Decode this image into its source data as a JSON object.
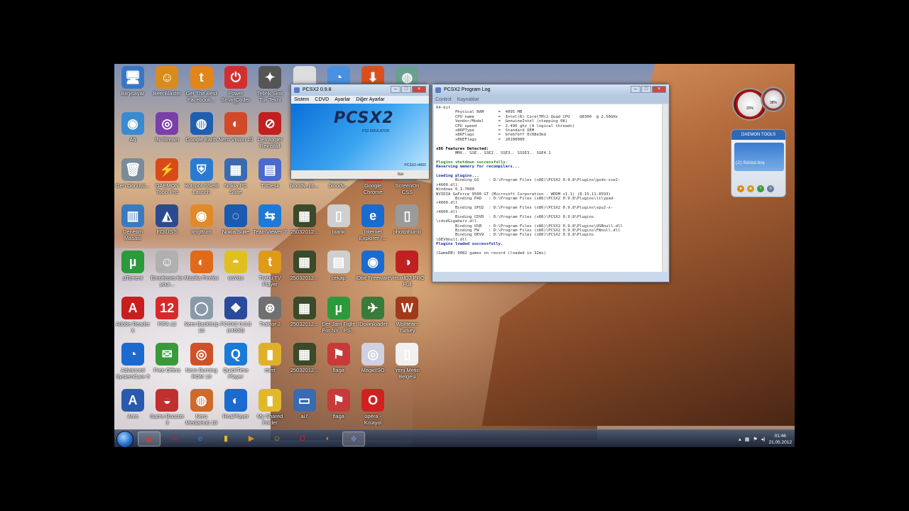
{
  "desktop": {
    "icons": [
      {
        "label": "Bilgisayar",
        "color": "#3a76c4",
        "glyph": "🖥",
        "col": 0,
        "row": 0
      },
      {
        "label": "BeerBlaster",
        "color": "#d88c1e",
        "glyph": "☺",
        "col": 1,
        "row": 0
      },
      {
        "label": "Get The Best Facebook...",
        "color": "#e0861a",
        "glyph": "t",
        "col": 2,
        "row": 0
      },
      {
        "label": "Power SmartCoder 10",
        "color": "#d23030",
        "glyph": "⏻",
        "col": 3,
        "row": 0
      },
      {
        "label": "Tebrik Sinir Tür Tekni",
        "color": "#555",
        "glyph": "✦",
        "col": 4,
        "row": 0
      },
      {
        "label": "Ağ",
        "color": "#3a8ad0",
        "glyph": "◉",
        "col": 0,
        "row": 1
      },
      {
        "label": "IN Stream",
        "color": "#7a3fa8",
        "glyph": "◎",
        "col": 1,
        "row": 1
      },
      {
        "label": "Google Earth",
        "color": "#1e5fb0",
        "glyph": "◍",
        "col": 2,
        "row": 1
      },
      {
        "label": "Nero Vision 10",
        "color": "#d04a2a",
        "glyph": "◐",
        "col": 3,
        "row": 1
      },
      {
        "label": "Defraggler Reinstall",
        "color": "#c02020",
        "glyph": "⊘",
        "col": 4,
        "row": 1
      },
      {
        "label": "Geri Dönüşü...",
        "color": "#7a8b9a",
        "glyph": "🗑",
        "col": 0,
        "row": 2
      },
      {
        "label": "DAEMON Tools Pro",
        "color": "#d84a1a",
        "glyph": "⚡",
        "col": 1,
        "row": 2
      },
      {
        "label": "Hotspot Shield Launch",
        "color": "#2a7ad0",
        "glyph": "⛨",
        "col": 2,
        "row": 2
      },
      {
        "label": "Nokia PC Suite",
        "color": "#3a6ab0",
        "glyph": "▦",
        "col": 3,
        "row": 2
      },
      {
        "label": "T3Desk",
        "color": "#4a6ad0",
        "glyph": "▤",
        "col": 4,
        "row": 2
      },
      {
        "label": "Denetim Masası",
        "color": "#3a7ac0",
        "glyph": "▥",
        "col": 0,
        "row": 3
      },
      {
        "label": "EDIUS 5",
        "color": "#2a4a90",
        "glyph": "◭",
        "col": 1,
        "row": 3
      },
      {
        "label": "ImgBurn",
        "color": "#e08a2a",
        "glyph": "◉",
        "col": 2,
        "row": 3
      },
      {
        "label": "Nokia Suite",
        "color": "#1a5ab0",
        "glyph": "◌",
        "col": 3,
        "row": 3
      },
      {
        "label": "TeamViewer 7",
        "color": "#1e7ad6",
        "glyph": "⇆",
        "col": 4,
        "row": 3
      },
      {
        "label": "µTorrent",
        "color": "#2a9a3a",
        "glyph": "µ",
        "col": 0,
        "row": 4
      },
      {
        "label": "Emoticons for your...",
        "color": "#b0b0b0",
        "glyph": "☺",
        "col": 1,
        "row": 4
      },
      {
        "label": "Mozilla Firefox",
        "color": "#e06a1a",
        "glyph": "◐",
        "col": 2,
        "row": 4
      },
      {
        "label": "ooVoo",
        "color": "#e0c020",
        "glyph": "◓",
        "col": 3,
        "row": 4
      },
      {
        "label": "Tivibu TV Player",
        "color": "#e09a1a",
        "glyph": "t",
        "col": 4,
        "row": 4
      },
      {
        "label": "Adobe Reader X",
        "color": "#c81e1e",
        "glyph": "A",
        "col": 0,
        "row": 5
      },
      {
        "label": "FIFA 12",
        "color": "#d82a2a",
        "glyph": "12",
        "col": 1,
        "row": 5
      },
      {
        "label": "Nero BackItUp 10",
        "color": "#8a9aa8",
        "glyph": "◯",
        "col": 2,
        "row": 5
      },
      {
        "label": "PCSX2 0.9.8 (r4600)",
        "color": "#2a4a9a",
        "glyph": "❖",
        "col": 3,
        "row": 5
      },
      {
        "label": "Traktor 2",
        "color": "#707070",
        "glyph": "⊛",
        "col": 4,
        "row": 5
      },
      {
        "label": "Advanced SystemCare 5",
        "color": "#1a6ad0",
        "glyph": "◔",
        "col": 0,
        "row": 6
      },
      {
        "label": "Free Offers",
        "color": "#3a9a3a",
        "glyph": "✉",
        "col": 1,
        "row": 6
      },
      {
        "label": "Nero Burning ROM 10",
        "color": "#d0502a",
        "glyph": "◎",
        "col": 2,
        "row": 6
      },
      {
        "label": "QuickTime Player",
        "color": "#1a7ad8",
        "glyph": "Q",
        "col": 3,
        "row": 6
      },
      {
        "label": "mert",
        "color": "#e0b02a",
        "glyph": "▮",
        "col": 4,
        "row": 6
      },
      {
        "label": "Ares",
        "color": "#2a5ab0",
        "glyph": "A",
        "col": 0,
        "row": 7
      },
      {
        "label": "Game Booster 3",
        "color": "#c03030",
        "glyph": "◒",
        "col": 1,
        "row": 7
      },
      {
        "label": "Nero MediaHub 10",
        "color": "#d06a2a",
        "glyph": "◍",
        "col": 2,
        "row": 7
      },
      {
        "label": "RealPlayer",
        "color": "#1a6ad0",
        "glyph": "◐",
        "col": 3,
        "row": 7
      },
      {
        "label": "My Shared Folder",
        "color": "#e0b82a",
        "glyph": "▮",
        "col": 4,
        "row": 7
      },
      {
        "label": "",
        "color": "#ddd",
        "glyph": "",
        "col": 5,
        "row": 0
      },
      {
        "label": "",
        "color": "#4a90e0",
        "glyph": "◔",
        "col": 6,
        "row": 0
      },
      {
        "label": "",
        "color": "#d85020",
        "glyph": "⬇",
        "col": 7,
        "row": 0
      },
      {
        "label": "",
        "color": "#6aa090",
        "glyph": "◍",
        "col": 8,
        "row": 0
      },
      {
        "label": "bloody_ps...",
        "color": "#9a9a9a",
        "glyph": "▦",
        "col": 5,
        "row": 2
      },
      {
        "label": "bloody...",
        "color": "#9a9a9a",
        "glyph": "▦",
        "col": 6,
        "row": 2
      },
      {
        "label": "Google Chrome",
        "color": "#d04030",
        "glyph": "◉",
        "col": 7,
        "row": 2
      },
      {
        "label": "ScreenOn CSS",
        "color": "#8a8a8a",
        "glyph": "▦",
        "col": 8,
        "row": 2
      },
      {
        "label": "25032012...",
        "color": "#3a4a2a",
        "glyph": "▦",
        "col": 5,
        "row": 3
      },
      {
        "label": "blank",
        "color": "#cfcfcf",
        "glyph": "▯",
        "col": 6,
        "row": 3
      },
      {
        "label": "Internet Explorer (...",
        "color": "#1a6ad0",
        "glyph": "e",
        "col": 7,
        "row": 3
      },
      {
        "label": "photothumb",
        "color": "#9a9a9a",
        "glyph": "▯",
        "col": 8,
        "row": 3
      },
      {
        "label": "25032012...",
        "color": "#3a4a2a",
        "glyph": "▦",
        "col": 5,
        "row": 4
      },
      {
        "label": "cekap",
        "color": "#cfcfcf",
        "glyph": "▤",
        "col": 6,
        "row": 4
      },
      {
        "label": "IObit Freeware",
        "color": "#1a6ad0",
        "glyph": "◉",
        "col": 7,
        "row": 4
      },
      {
        "label": "VirtualDJ PRO Full",
        "color": "#c02020",
        "glyph": "◑",
        "col": 8,
        "row": 4
      },
      {
        "label": "25032012...",
        "color": "#3a4a2a",
        "glyph": "▦",
        "col": 5,
        "row": 5
      },
      {
        "label": "Def Jam Fight For NY - PS...",
        "color": "#2a9a3a",
        "glyph": "µ",
        "col": 6,
        "row": 5
      },
      {
        "label": "IDownloader",
        "color": "#3a7a3a",
        "glyph": "✈",
        "col": 7,
        "row": 5
      },
      {
        "label": "Wolfteam Turkey",
        "color": "#a03a1a",
        "glyph": "W",
        "col": 8,
        "row": 5
      },
      {
        "label": "25032012...",
        "color": "#3a4a2a",
        "glyph": "▦",
        "col": 5,
        "row": 6
      },
      {
        "label": "flaga",
        "color": "#c83a3a",
        "glyph": "⚑",
        "col": 6,
        "row": 6
      },
      {
        "label": "MagicISO",
        "color": "#d0d0e0",
        "glyph": "◎",
        "col": 7,
        "row": 6
      },
      {
        "label": "Yeni Metin Belgesi",
        "color": "#f0f0f0",
        "glyph": "▯",
        "col": 8,
        "row": 6
      },
      {
        "label": "ai7",
        "color": "#3a6ab0",
        "glyph": "▭",
        "col": 5,
        "row": 7
      },
      {
        "label": "flaga",
        "color": "#c83a3a",
        "glyph": "⚑",
        "col": 6,
        "row": 7
      },
      {
        "label": "opera - Kısayol",
        "color": "#d02020",
        "glyph": "O",
        "col": 7,
        "row": 7
      }
    ]
  },
  "pcsx2_window": {
    "title": "PCSX2  0.9.8",
    "menu": [
      "Sistem",
      "CDVD",
      "Ayarlar",
      "Diğer Ayarlar"
    ],
    "logo": "PCSX2",
    "logo_sub": "PS2 EMULATOR",
    "version_tag": "PCSX2 r4600",
    "status": "Iso"
  },
  "log_window": {
    "title": "PCSX2 Program Log",
    "menu": [
      "Control",
      "Kaynaklar"
    ],
    "lines": [
      {
        "t": "64-bit",
        "c": ""
      },
      {
        "t": "        Physical RAM      =  4095 MB",
        "c": ""
      },
      {
        "t": "        CPU name          =  Intel(R) Core(TM)2 Quad CPU    Q8300  @ 2.50GHz",
        "c": ""
      },
      {
        "t": "        Vendor/Model      =  GenuineIntel (stepping 0A)",
        "c": ""
      },
      {
        "t": "        CPU speed         =  2.496 ghz (4 logical threads)",
        "c": ""
      },
      {
        "t": "        x86PType          =  Standard OEM",
        "c": ""
      },
      {
        "t": "        x86Flags          =  bfebfbff 0c08e3bd",
        "c": ""
      },
      {
        "t": "        x86EFlags         =  20100000",
        "c": ""
      },
      {
        "t": "",
        "c": ""
      },
      {
        "t": "x86 Features Detected:",
        "c": "hl"
      },
      {
        "t": "        MMX.. SSE.. SSE2.. SSE3.. SSSE3.. SSE4.1",
        "c": ""
      },
      {
        "t": "",
        "c": ""
      },
      {
        "t": "Plugins shutdown successfully.",
        "c": "ok"
      },
      {
        "t": "Reserving memory for recompilers...",
        "c": "blue"
      },
      {
        "t": "",
        "c": ""
      },
      {
        "t": "Loading plugins...",
        "c": "blue"
      },
      {
        "t": "        Binding GS    : D:\\Program Files (x86)\\PCSX2 0.9.8\\Plugins\\gsdx-sse2-",
        "c": ""
      },
      {
        "t": "r4600.dll",
        "c": ""
      },
      {
        "t": "Windows 6.1.7600",
        "c": ""
      },
      {
        "t": "NVIDIA GeForce 9500 GT (Microsoft Corporation - WDDM v1.1) (8.15.11.8593)",
        "c": ""
      },
      {
        "t": "        Binding PAD   : D:\\Program Files (x86)\\PCSX2 0.9.8\\Plugins\\lilypad-",
        "c": ""
      },
      {
        "t": "r4600.dll",
        "c": ""
      },
      {
        "t": "        Binding SPU2  : D:\\Program Files (x86)\\PCSX2 0.9.8\\Plugins\\spu2-x-",
        "c": ""
      },
      {
        "t": "r4600.dll",
        "c": ""
      },
      {
        "t": "        Binding CDVD  : D:\\Program Files (x86)\\PCSX2 0.9.8\\Plugins",
        "c": ""
      },
      {
        "t": "\\cdvdGigaherz.dll",
        "c": ""
      },
      {
        "t": "        Binding USB   : D:\\Program Files (x86)\\PCSX2 0.9.8\\Plugins\\USBnull.dll",
        "c": ""
      },
      {
        "t": "        Binding FW    : D:\\Program Files (x86)\\PCSX2 0.9.8\\Plugins\\FWnull.dll",
        "c": ""
      },
      {
        "t": "        Binding DEV9  : D:\\Program Files (x86)\\PCSX2 0.9.8\\Plugins",
        "c": ""
      },
      {
        "t": "\\DEV9null.dll",
        "c": ""
      },
      {
        "t": "Plugins loaded successfully.",
        "c": "blue"
      },
      {
        "t": "",
        "c": ""
      },
      {
        "t": "(GameDB) 9082 games on record (loaded in 32ms)",
        "c": ""
      }
    ]
  },
  "daemon_gadget": {
    "header": "DAEMON TOOLS",
    "drive": "(J:) Sürücü boş"
  },
  "gauges": {
    "cpu": "20%",
    "ram": "38%"
  },
  "taskbar": {
    "apps": [
      {
        "name": "chrome",
        "glyph": "◉",
        "color": "#d04030"
      },
      {
        "name": "adobe-reader",
        "glyph": "A",
        "color": "#c81e1e"
      },
      {
        "name": "internet-explorer",
        "glyph": "e",
        "color": "#1a8ae0"
      },
      {
        "name": "explorer",
        "glyph": "▮",
        "color": "#e0b82a"
      },
      {
        "name": "media-player",
        "glyph": "▶",
        "color": "#e08a1a"
      },
      {
        "name": "beerblaster",
        "glyph": "☺",
        "color": "#d88c1e"
      },
      {
        "name": "opera",
        "glyph": "O",
        "color": "#d02020"
      },
      {
        "name": "firefox",
        "glyph": "◐",
        "color": "#e06a1a"
      },
      {
        "name": "pcsx2",
        "glyph": "❖",
        "color": "#6a8ad0"
      }
    ],
    "time": "01:46",
    "date": "21.05.2012"
  }
}
